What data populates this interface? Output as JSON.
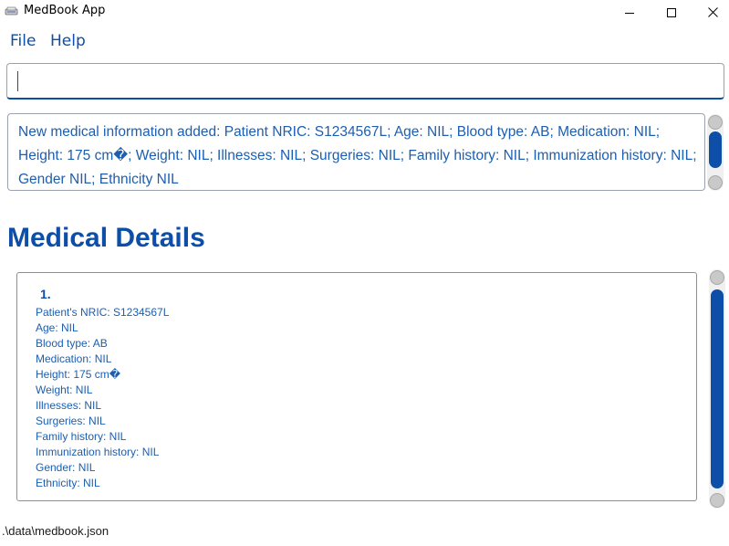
{
  "window": {
    "title": "MedBook App",
    "icon": "app-logo-icon"
  },
  "menu": {
    "file": "File",
    "help": "Help"
  },
  "command_box": {
    "value": ""
  },
  "result_display": {
    "text": "New medical information added: Patient NRIC: S1234567L; Age: NIL; Blood type: AB; Medication: NIL; Height: 175 cm�; Weight: NIL; Illnesses: NIL; Surgeries: NIL; Family history: NIL; Immunization history: NIL; Gender NIL; Ethnicity NIL"
  },
  "section": {
    "title": "Medical Details"
  },
  "records": [
    {
      "index": "1.",
      "fields": [
        "Patient's NRIC: S1234567L",
        "Age: NIL",
        "Blood type: AB",
        "Medication: NIL",
        "Height: 175 cm�",
        "Weight: NIL",
        "Illnesses: NIL",
        "Surgeries: NIL",
        "Family history: NIL",
        "Immunization history: NIL",
        "Gender: NIL",
        "Ethnicity: NIL"
      ]
    }
  ],
  "status_bar": {
    "path": ".\\data\\medbook.json"
  },
  "colors": {
    "accent": "#0c4ea8",
    "text_blue": "#1c5eb0"
  }
}
